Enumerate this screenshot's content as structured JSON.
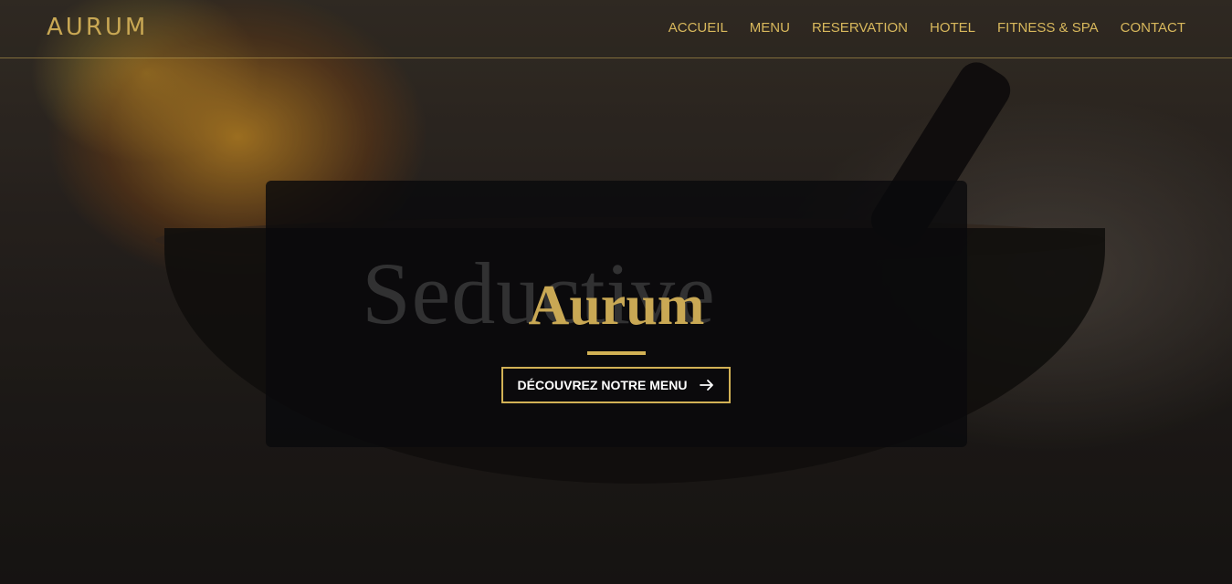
{
  "nav": {
    "logo": "AURUM",
    "items": [
      {
        "label": "ACCUEIL"
      },
      {
        "label": "MENU"
      },
      {
        "label": "RESERVATION"
      },
      {
        "label": "HOTEL"
      },
      {
        "label": "FITNESS & SPA"
      },
      {
        "label": "CONTACT"
      }
    ]
  },
  "hero": {
    "background_text": "Seductive",
    "title": "Aurum",
    "cta_label": "DÉCOUVREZ NOTRE MENU",
    "cta_icon": "arrow-right-icon"
  },
  "colors": {
    "accent": "#c9a854",
    "card": "#0a0a0c",
    "text_light": "#ffffff"
  }
}
